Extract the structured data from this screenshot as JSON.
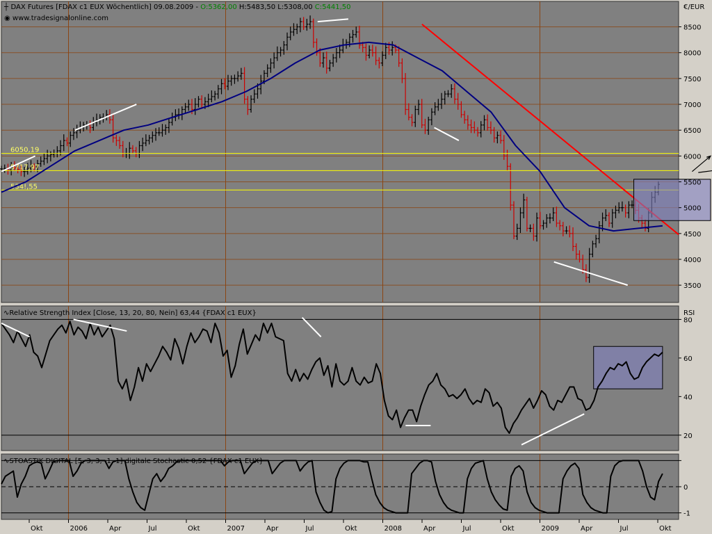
{
  "panels": {
    "price": {
      "title_prefix": "DAX Futures [FDAX c1 EUX  Wöchentlich] 09.08.2009 - ",
      "open": "O:5362,00",
      "high": " H:5483,50",
      "low": " L:5308,00",
      "close": " C:5441,50",
      "website": "www.tradesignalonline.com",
      "unit": "€/EUR"
    },
    "rsi": {
      "title": "Relative Strength Index [Close, 13, 20, 80, Nein] 63,44 {FDAX c1 EUX}",
      "axis_label": "RSI"
    },
    "stoch": {
      "title": "STOASTIK DIGITAL [5, 3, 3, -1, 1] digitale Stochastic 0,52 {FDAX c1 EUX}"
    }
  },
  "colors": {
    "background": "#808080",
    "frame": "#d4d0c8",
    "grid": "#8b4513",
    "up_bar": "#000000",
    "down_bar": "#cc0000",
    "moving_average": "#000080",
    "trendline": "#ff0000",
    "support_lines": "#ffff00",
    "annotation": "#ffffff",
    "box_fill": "#8080c0",
    "open_value": "#008000",
    "close_value": "#008000"
  },
  "chart_data": [
    {
      "type": "candlestick",
      "title": "DAX Futures [FDAX c1 EUX  Wöchentlich] 09.08.2009",
      "ylabel": "€/EUR",
      "ylim": [
        3300,
        8750
      ],
      "yticks": [
        3500,
        4000,
        4500,
        5000,
        5500,
        6000,
        6500,
        7000,
        7500,
        8000,
        8500
      ],
      "ytick_labels": [
        "3500",
        "4000",
        "4500",
        "5000",
        "5500",
        "6000",
        "6500",
        "7000",
        "7500",
        "8000",
        "8500"
      ],
      "x_labels": [
        "Okt",
        "2006",
        "Apr",
        "Jul",
        "Okt",
        "2007",
        "Apr",
        "Jul",
        "Okt",
        "2008",
        "Apr",
        "Jul",
        "Okt",
        "2009",
        "Apr",
        "Jul",
        "Okt"
      ],
      "xlim": [
        0,
        214
      ],
      "grid": true,
      "ohlc": {
        "open": 5362.0,
        "high": 5483.5,
        "low": 5308.0,
        "close": 5441.5
      },
      "horizontal_levels": [
        {
          "value": 6050.19,
          "label": "6050,19"
        },
        {
          "value": 5717.97,
          "label": "5717,97"
        },
        {
          "value": 5341.55,
          "label": "534!,55"
        }
      ],
      "series": [
        {
          "role": "close",
          "step_weeks": 1,
          "values": [
            5750,
            5760,
            5730,
            5780,
            5770,
            5740,
            5700,
            5700,
            5760,
            5800,
            5790,
            5850,
            5900,
            5950,
            6000,
            6030,
            6050,
            6100,
            6200,
            6300,
            6250,
            6400,
            6450,
            6500,
            6550,
            6600,
            6600,
            6550,
            6650,
            6700,
            6750,
            6750,
            6800,
            6700,
            6350,
            6300,
            6200,
            6050,
            6050,
            6150,
            6100,
            6050,
            6200,
            6250,
            6300,
            6350,
            6400,
            6450,
            6450,
            6500,
            6550,
            6650,
            6750,
            6800,
            6800,
            6900,
            6950,
            7000,
            6900,
            7000,
            7100,
            7000,
            7050,
            7100,
            7150,
            7200,
            7300,
            7400,
            7350,
            7450,
            7500,
            7500,
            7550,
            7600,
            7100,
            6900,
            7100,
            7200,
            7300,
            7450,
            7600,
            7700,
            7800,
            7900,
            8000,
            8050,
            8150,
            8300,
            8400,
            8450,
            8500,
            8600,
            8500,
            8550,
            8600,
            8200,
            8000,
            7800,
            7900,
            7700,
            7800,
            7900,
            8000,
            8050,
            8150,
            8200,
            8300,
            8350,
            8400,
            8150,
            8100,
            7950,
            8050,
            8000,
            7850,
            7800,
            7950,
            8100,
            8050,
            8100,
            8050,
            7800,
            7500,
            6900,
            6750,
            6650,
            6900,
            7000,
            6600,
            6500,
            6700,
            6850,
            6950,
            7000,
            7100,
            7200,
            7200,
            7300,
            7100,
            7000,
            6800,
            6700,
            6600,
            6550,
            6500,
            6450,
            6600,
            6700,
            6550,
            6500,
            6350,
            6400,
            6300,
            6000,
            5800,
            5050,
            4450,
            4600,
            4900,
            5150,
            4600,
            4600,
            4450,
            4800,
            4650,
            4700,
            4800,
            4800,
            4900,
            4700,
            4650,
            4550,
            4550,
            4500,
            4250,
            4100,
            4000,
            3800,
            3650,
            4100,
            4300,
            4400,
            4650,
            4800,
            4850,
            4700,
            4900,
            4950,
            5000,
            5000,
            4900,
            5050,
            5050,
            4950,
            4800,
            4700,
            4600,
            4900,
            5200,
            5300,
            5450
          ],
          "points": 182
        },
        {
          "name": "",
          "role": "moving_average",
          "values": [
            5300,
            5500,
            5800,
            6100,
            6300,
            6500,
            6600,
            6750,
            6900,
            7050,
            7250,
            7500,
            7800,
            8050,
            8150,
            8200,
            8150,
            7900,
            7650,
            7250,
            6850,
            6200,
            5700,
            5000,
            4650,
            4550,
            4600,
            4650
          ]
        },
        {
          "role": "trendline",
          "from": [
            137,
            8550
          ],
          "to": [
            214,
            4480
          ]
        }
      ],
      "annotations": [
        {
          "type": "trendline",
          "from": [
            0,
            5700
          ],
          "to": [
            11,
            6000
          ]
        },
        {
          "type": "trendline",
          "from": [
            24,
            6500
          ],
          "to": [
            44,
            7000
          ]
        },
        {
          "type": "trendline",
          "from": [
            103,
            8600
          ],
          "to": [
            113,
            8650
          ]
        },
        {
          "type": "trendline",
          "from": [
            141,
            6550
          ],
          "to": [
            149,
            6300
          ]
        },
        {
          "type": "trendline",
          "from": [
            180,
            3950
          ],
          "to": [
            204,
            3500
          ]
        },
        {
          "type": "box",
          "x": [
            206,
            231
          ],
          "y": [
            4750,
            5550
          ]
        },
        {
          "type": "arrow",
          "from": [
            225,
            5700
          ],
          "to": [
            231,
            6000
          ]
        },
        {
          "type": "arrow",
          "from": [
            227,
            5680
          ],
          "to": [
            236,
            5750
          ]
        }
      ]
    },
    {
      "type": "line",
      "title": "Relative Strength Index [Close, 13, 20, 80, Nein] 63,44",
      "ylabel": "RSI",
      "ylim": [
        12,
        87
      ],
      "yticks": [
        20,
        40,
        60,
        80
      ],
      "ytick_labels": [
        "20",
        "40",
        "60",
        "80"
      ],
      "reference_lines": [
        20,
        80
      ],
      "series": [
        {
          "name": "RSI",
          "values": [
            78,
            75,
            72,
            68,
            74,
            70,
            66,
            72,
            63,
            61,
            55,
            62,
            69,
            72,
            75,
            77,
            73,
            79,
            72,
            76,
            74,
            70,
            78,
            72,
            76,
            71,
            74,
            77,
            70,
            48,
            44,
            49,
            38,
            45,
            55,
            48,
            57,
            53,
            57,
            61,
            66,
            63,
            59,
            70,
            65,
            57,
            66,
            73,
            68,
            71,
            75,
            74,
            68,
            78,
            73,
            61,
            64,
            50,
            56,
            67,
            75,
            62,
            67,
            72,
            69,
            78,
            73,
            78,
            71,
            70,
            69,
            52,
            48,
            54,
            48,
            52,
            49,
            54,
            58,
            60,
            51,
            56,
            45,
            57,
            48,
            46,
            48,
            55,
            48,
            46,
            50,
            47,
            48,
            57,
            52,
            38,
            30,
            28,
            33,
            24,
            29,
            33,
            33,
            27,
            35,
            41,
            46,
            48,
            52,
            46,
            44,
            40,
            41,
            39,
            41,
            44,
            39,
            36,
            38,
            37,
            44,
            42,
            35,
            37,
            34,
            24,
            21,
            26,
            29,
            33,
            36,
            39,
            34,
            38,
            43,
            41,
            35,
            33,
            38,
            37,
            41,
            45,
            45,
            39,
            38,
            33,
            34,
            38,
            45,
            48,
            52,
            55,
            54,
            57,
            56,
            58,
            52,
            49,
            50,
            55,
            58,
            60,
            62,
            61,
            63
          ]
        }
      ],
      "annotations": [
        {
          "type": "trendline",
          "from": [
            0,
            78
          ],
          "to": [
            9,
            71
          ]
        },
        {
          "type": "trendline",
          "from": [
            23,
            80
          ],
          "to": [
            40,
            74
          ]
        },
        {
          "type": "trendline",
          "from": [
            96,
            81
          ],
          "to": [
            102,
            71
          ]
        },
        {
          "type": "trendline",
          "from": [
            129,
            25
          ],
          "to": [
            137,
            25
          ]
        },
        {
          "type": "trendline",
          "from": [
            166,
            15
          ],
          "to": [
            186,
            31
          ]
        },
        {
          "type": "box",
          "x": [
            189,
            211
          ],
          "y": [
            44,
            66
          ]
        }
      ]
    },
    {
      "type": "line",
      "title": "STOASTIK DIGITAL [5, 3, 3, -1, 1] digitale Stochastic 0,52",
      "ylim": [
        -1.25,
        1.25
      ],
      "yticks": [
        -1,
        0,
        1
      ],
      "ytick_labels": [
        "-1",
        "0",
        ""
      ],
      "reference_lines": [
        -1,
        0,
        1
      ],
      "series": [
        {
          "name": "Stochastic",
          "values": [
            0.1,
            0.4,
            0.5,
            0.6,
            -0.4,
            0.1,
            0.4,
            0.8,
            0.9,
            0.95,
            0.9,
            0.3,
            0.6,
            0.95,
            1,
            1,
            1,
            1,
            0.4,
            0.6,
            0.9,
            1,
            1,
            1,
            1,
            1,
            1,
            0.7,
            0.95,
            1,
            1,
            1,
            0.3,
            -0.2,
            -0.6,
            -0.8,
            -0.9,
            -0.3,
            0.3,
            0.5,
            0.2,
            0.4,
            0.7,
            0.8,
            0.95,
            1,
            1,
            1,
            1,
            1,
            1,
            1,
            1,
            1,
            1,
            1,
            0.8,
            0.95,
            1,
            1,
            1,
            0.5,
            0.7,
            0.9,
            1,
            1,
            1,
            1,
            0.5,
            0.7,
            0.9,
            1,
            1,
            1,
            1,
            0.6,
            0.8,
            0.95,
            1,
            -0.2,
            -0.6,
            -0.9,
            -1,
            -0.95,
            0.3,
            0.7,
            0.9,
            1,
            1,
            1,
            1,
            0.95,
            0.95,
            0.3,
            -0.3,
            -0.6,
            -0.8,
            -0.9,
            -0.95,
            -1,
            -1,
            -1,
            -1,
            0.5,
            0.7,
            0.9,
            1,
            1,
            0.95,
            0.2,
            -0.3,
            -0.6,
            -0.8,
            -0.9,
            -0.95,
            -1,
            -1,
            0.3,
            0.7,
            0.9,
            0.95,
            1,
            0.3,
            -0.2,
            -0.5,
            -0.7,
            -0.85,
            -0.9,
            0.4,
            0.7,
            0.8,
            0.6,
            -0.2,
            -0.6,
            -0.8,
            -0.9,
            -0.95,
            -1,
            -1,
            -1,
            -1,
            0.3,
            0.6,
            0.8,
            0.9,
            0.7,
            -0.3,
            -0.6,
            -0.8,
            -0.9,
            -0.95,
            -1,
            -1,
            0.4,
            0.8,
            0.95,
            1,
            1,
            1,
            1,
            1,
            0.6,
            0.0,
            -0.4,
            -0.5,
            0.2,
            0.5
          ]
        }
      ]
    }
  ]
}
